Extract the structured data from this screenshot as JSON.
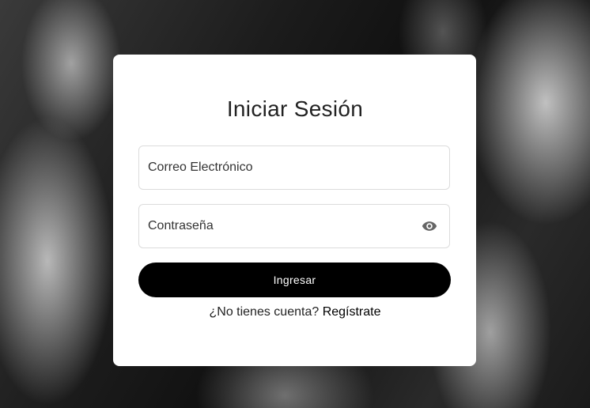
{
  "login": {
    "title": "Iniciar Sesión",
    "email_placeholder": "Correo Electrónico",
    "password_placeholder": "Contraseña",
    "toggle_password_icon": "eye-icon",
    "submit_label": "Ingresar",
    "register_prompt": "¿No tienes cuenta?",
    "register_link": "Regístrate"
  },
  "colors": {
    "card_background": "#ffffff",
    "button_background": "#000000",
    "button_text": "#ffffff",
    "field_border": "#dcdcdc"
  }
}
